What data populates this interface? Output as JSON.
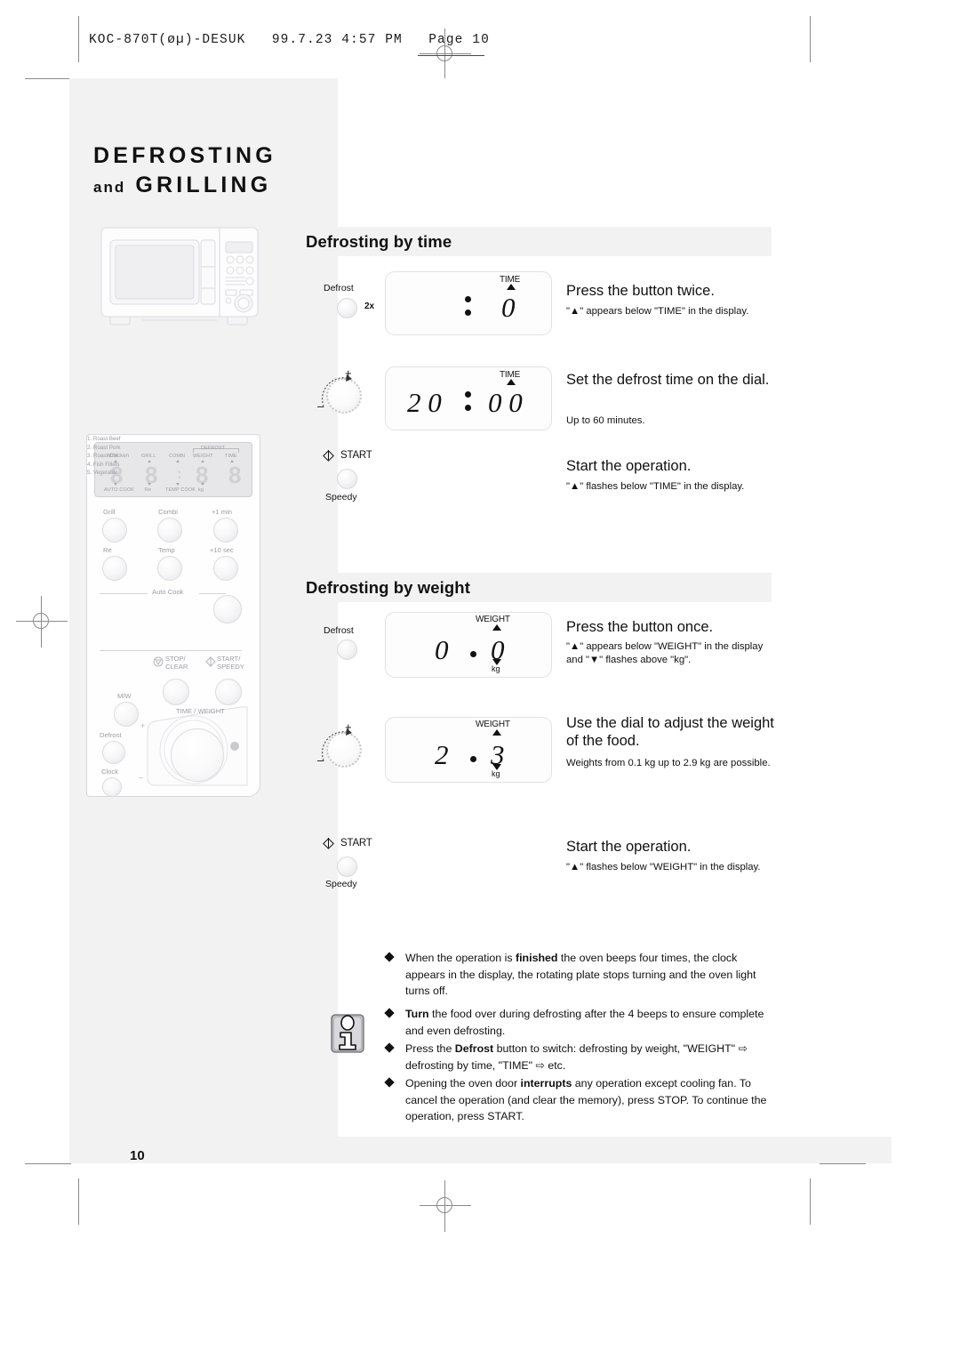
{
  "printer": {
    "slug": "KOC-870T(øµ)-DESUK   99.7.23 4:57 PM   Page 10"
  },
  "chapter": {
    "line1": "DEFROSTING",
    "line2_small": "and",
    "line2_big": "GRILLING"
  },
  "folio": "10",
  "panel": {
    "lcd": {
      "top_labels": [
        "M/W",
        "GRILL",
        "COMBI",
        "WEIGHT",
        "TIME"
      ],
      "bracket_label": "DEFROST",
      "bottom_labels": [
        "AUTO COOK",
        "Re",
        "TEMP COOK",
        "kg"
      ],
      "digits": [
        "8",
        "8",
        "8",
        "8"
      ],
      "colon": ":"
    },
    "buttons": [
      {
        "label": "Grill"
      },
      {
        "label": "Combi"
      },
      {
        "label": "+1 min"
      },
      {
        "label": "Re"
      },
      {
        "label": "Temp"
      },
      {
        "label": "+10 sec"
      }
    ],
    "autocook_title": "Auto Cook",
    "autocook_items": [
      "1. Roast Beef",
      "2. Roast Pork",
      "3. Roast Chicken",
      "4. Fish Fillets",
      "5. Vegetable"
    ],
    "stop_label_1": "STOP/",
    "stop_label_2": "CLEAR",
    "start_label_1": "START/",
    "start_label_2": "SPEEDY",
    "mw_label": "M/W",
    "defrost_label": "Defrost",
    "clock_label": "Clock",
    "dial_label": "TIME / WEIGHT",
    "dial_plus": "+",
    "dial_minus": "–"
  },
  "sections": [
    {
      "id": "defrost-by-time",
      "heading": "Defrosting by time",
      "steps": [
        {
          "control": "defrost-button",
          "control_caption": "Defrost",
          "control_badge": "2x",
          "display": {
            "kind": "time",
            "label": "TIME",
            "digits_left": "",
            "digits_right": "0",
            "colon": ":"
          },
          "title": "Press the button twice.",
          "sub": "\"▲\" appears below \"TIME\" in the display."
        },
        {
          "control": "dial",
          "display": {
            "kind": "time",
            "label": "TIME",
            "digits_left": "2 0",
            "digits_right": "0 0",
            "colon": ":"
          },
          "title": "Set the defrost time on the dial.",
          "sub": "Up to 60 minutes."
        },
        {
          "control": "start-button",
          "control_label": "START",
          "control_caption": "Speedy",
          "title": "Start the operation.",
          "sub": "\"▲\" flashes below \"TIME\" in the display."
        }
      ]
    },
    {
      "id": "defrost-by-weight",
      "heading": "Defrosting by weight",
      "steps": [
        {
          "control": "defrost-button",
          "control_caption": "Defrost",
          "display": {
            "kind": "weight",
            "label": "WEIGHT",
            "unit": "kg",
            "digits_left": "0",
            "digits_right": "0"
          },
          "title": "Press the button once.",
          "sub": "\"▲\" appears below \"WEIGHT\" in the display and \"▼\" flashes above \"kg\"."
        },
        {
          "control": "dial",
          "display": {
            "kind": "weight",
            "label": "WEIGHT",
            "unit": "kg",
            "digits_left": "2",
            "digits_right": "3"
          },
          "title": "Use the dial to adjust the weight of the food.",
          "sub": "Weights from 0.1 kg up to 2.9 kg are possible."
        },
        {
          "control": "start-button",
          "control_label": "START",
          "control_caption": "Speedy",
          "title": "Start the operation.",
          "sub": "\"▲\" flashes below \"WEIGHT\" in the display."
        }
      ]
    }
  ],
  "notes": [
    {
      "html": "When the operation is <b>finished</b> the oven beeps four times, the clock appears in the display, the rotating plate stops turning and the oven light turns off."
    },
    {
      "html": "<b>Turn</b> the food over during defrosting after the 4 beeps to ensure complete and even defrosting."
    },
    {
      "html": "Press the <b>Defrost</b> button to switch: defrosting by weight, \"WEIGHT\" ⇨ defrosting by time, \"TIME\" ⇨ etc."
    },
    {
      "html": "Opening the oven door <b>interrupts</b> any operation except cooling fan. To cancel the operation (and clear the memory), press STOP. To continue the operation, press START."
    }
  ],
  "colors": {
    "paper_gray": "#f2f2f2",
    "ink": "#111111",
    "panel_line": "#cfcfd4"
  }
}
